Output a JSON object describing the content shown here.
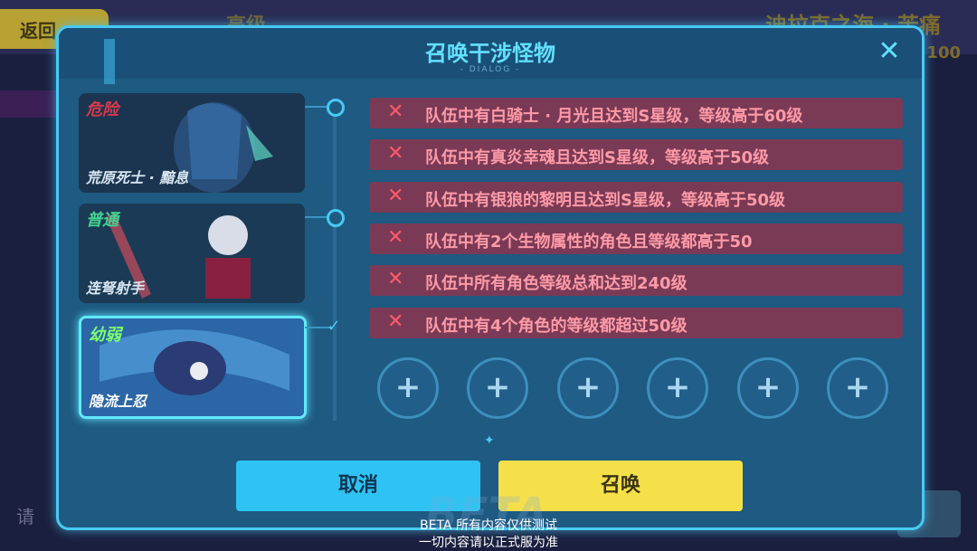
{
  "background": {
    "back_label": "返回",
    "title": "高级",
    "right_title": "迪拉克之海 · 苦痛",
    "right_number": "100",
    "left_hint": "请"
  },
  "dialog": {
    "title": "召唤干涉怪物",
    "subtitle": "- DIALOG -",
    "close_icon": "close-icon"
  },
  "monsters": [
    {
      "tier": "危险",
      "tier_color": "#d9394a",
      "name": "荒原死士 · 黯息"
    },
    {
      "tier": "普通",
      "tier_color": "#43d38f",
      "name": "连弩射手"
    },
    {
      "tier": "幼弱",
      "tier_color": "#7dff6e",
      "name": "隐流上忍",
      "selected": true
    }
  ],
  "conditions": [
    "队伍中有白骑士 · 月光且达到S星级，等级高于60级",
    "队伍中有真炎幸魂且达到S星级，等级高于50级",
    "队伍中有银狼的黎明且达到S星级，等级高于50级",
    "队伍中有2个生物属性的角色且等级都高于50",
    "队伍中所有角色等级总和达到240级",
    "队伍中有4个角色的等级都超过50级"
  ],
  "slots": [
    "+",
    "+",
    "+",
    "+",
    "+",
    "+"
  ],
  "buttons": {
    "cancel": "取消",
    "summon": "召唤"
  },
  "beta": {
    "watermark": "BETA",
    "note_line1": "BETA 所有内容仅供测试",
    "note_line2": "一切内容请以正式服为准"
  },
  "colors": {
    "accent": "#48c9f2",
    "condition_bg": "#7a3a56",
    "summon": "#f6e04a",
    "cancel": "#2ec3f3"
  }
}
